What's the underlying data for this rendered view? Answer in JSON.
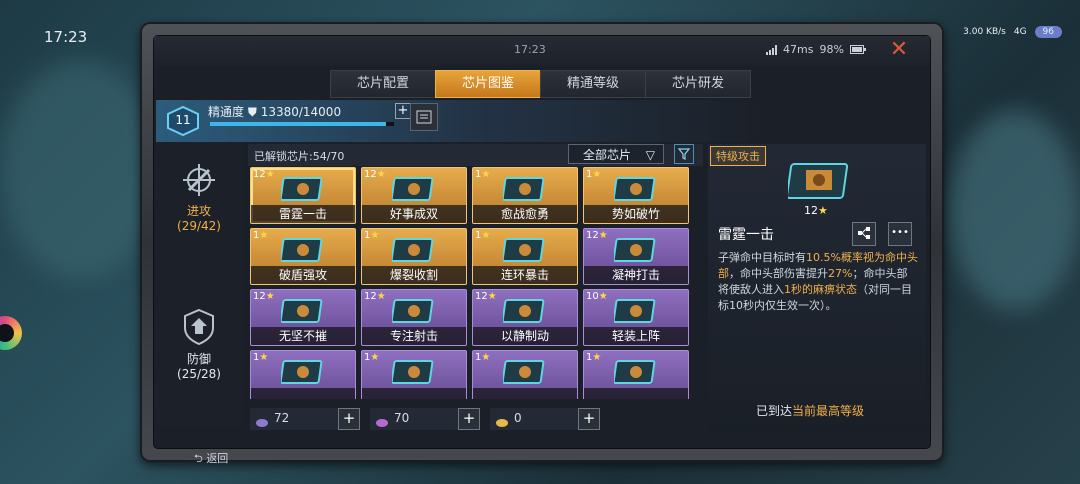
{
  "status_bar": {
    "time": "17:23",
    "speed": "3.00 KB/s",
    "network": "4G",
    "battery": "96"
  },
  "window": {
    "clock": "17:23",
    "ping": "47ms",
    "battery_pct": "98%"
  },
  "tabs": [
    {
      "label": "芯片配置",
      "active": false
    },
    {
      "label": "芯片图鉴",
      "active": true
    },
    {
      "label": "精通等级",
      "active": false
    },
    {
      "label": "芯片研发",
      "active": false
    }
  ],
  "mastery": {
    "level": "11",
    "label": "精通度",
    "value": "13380/14000",
    "progress": 0.9557
  },
  "sidebar": [
    {
      "name": "进攻",
      "count": "(29/42)",
      "active": true
    },
    {
      "name": "防御",
      "count": "(25/28)",
      "active": false
    }
  ],
  "list": {
    "unlocked": "已解锁芯片:54/70",
    "filter": "全部芯片"
  },
  "cards": [
    {
      "level": "12",
      "name": "雷霆一击",
      "rarity": "gold",
      "selected": true
    },
    {
      "level": "12",
      "name": "好事成双",
      "rarity": "gold"
    },
    {
      "level": "1",
      "name": "愈战愈勇",
      "rarity": "gold"
    },
    {
      "level": "1",
      "name": "势如破竹",
      "rarity": "gold"
    },
    {
      "level": "1",
      "name": "破盾强攻",
      "rarity": "gold"
    },
    {
      "level": "1",
      "name": "爆裂收割",
      "rarity": "gold"
    },
    {
      "level": "1",
      "name": "连环暴击",
      "rarity": "gold"
    },
    {
      "level": "12",
      "name": "凝神打击",
      "rarity": "purple"
    },
    {
      "level": "12",
      "name": "无坚不摧",
      "rarity": "purple"
    },
    {
      "level": "12",
      "name": "专注射击",
      "rarity": "purple"
    },
    {
      "level": "12",
      "name": "以静制动",
      "rarity": "purple"
    },
    {
      "level": "10",
      "name": "轻装上阵",
      "rarity": "purple"
    },
    {
      "level": "1",
      "name": "",
      "rarity": "purple"
    },
    {
      "level": "1",
      "name": "",
      "rarity": "purple"
    },
    {
      "level": "1",
      "name": "",
      "rarity": "purple"
    },
    {
      "level": "1",
      "name": "",
      "rarity": "purple"
    }
  ],
  "counters": [
    {
      "value": "72",
      "color": "#8f7ad0"
    },
    {
      "value": "70",
      "color": "#b56ad0"
    },
    {
      "value": "0",
      "color": "#e8b64a"
    }
  ],
  "detail": {
    "rarity_tag": "特级攻击",
    "level": "12",
    "name": "雷霆一击",
    "desc_1": "子弹命中目标时有",
    "desc_2": "10.5%概率视为命中头部",
    "desc_3": "，命中头部伤害提升",
    "desc_4": "27%",
    "desc_5": "；命中头部将使敌人进入",
    "desc_6": "1秒的麻痹状态",
    "desc_7": "（对同一目标10秒内仅生效一次）。",
    "max_prefix": "已到达",
    "max_hl": "当前最高等级"
  },
  "back": {
    "label": "返回"
  },
  "colors": {
    "gold": "#e6ac4c",
    "purple": "#8f6fc0",
    "accent": "#f0b04a",
    "close": "#d85b3a"
  }
}
